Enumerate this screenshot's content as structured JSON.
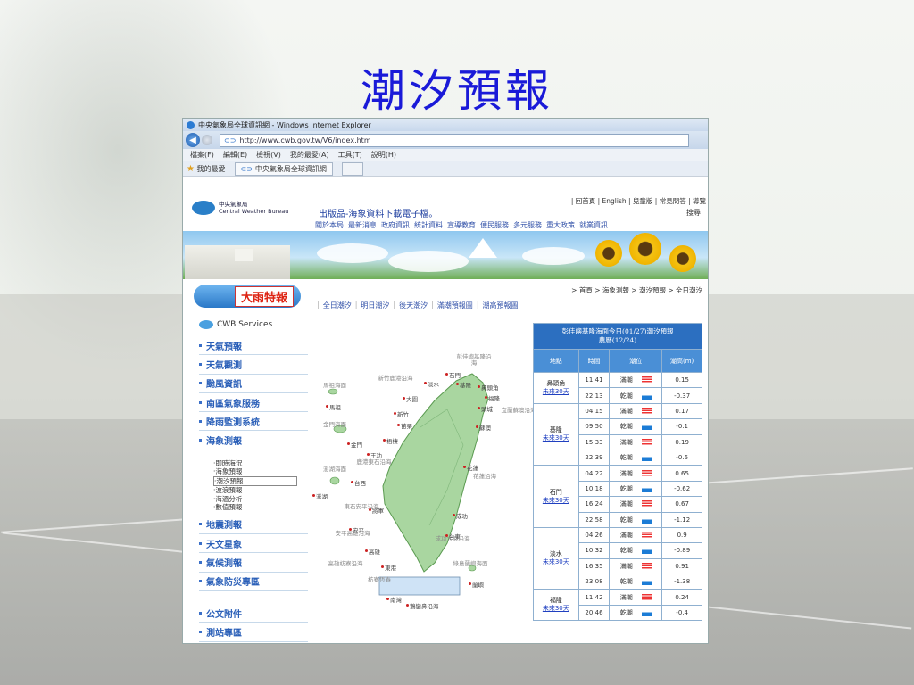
{
  "slide": {
    "title": "潮汐預報"
  },
  "browser": {
    "window_title": "中央氣象局全球資訊網 - Windows Internet Explorer",
    "url": "http://www.cwb.gov.tw/V6/index.htm",
    "menu": [
      "檔案(F)",
      "編輯(E)",
      "檢視(V)",
      "我的最愛(A)",
      "工具(T)",
      "說明(H)"
    ],
    "favorites_label": "我的最愛",
    "tab_label": "中央氣象局全球資訊網"
  },
  "site": {
    "logo_cn": "中央氣象局",
    "logo_en": "Central Weather Bureau",
    "top_links": "| 回首頁 | English | 兒童版 | 常見問答 | 導覽",
    "search_label": "搜尋",
    "promo": "出版品-海象資料下載電子檔。",
    "main_nav": [
      "關於本局",
      "最新消息",
      "政府資訊",
      "統計資料",
      "宣導教育",
      "便民服務",
      "多元服務",
      "重大政策",
      "就業資訊"
    ],
    "warning_label": "大雨特報",
    "breadcrumb": "> 首頁  > 海象測報  > 潮汐預報  > 全日潮汐",
    "tide_nav": [
      "全日潮汐",
      "明日潮汐",
      "後天潮汐",
      "滿潮預報圖",
      "潮高預報圖"
    ],
    "cwb_services": "CWB Services",
    "sidebar": [
      "天氣預報",
      "天氣觀測",
      "颱風資訊",
      "南區氣象服務",
      "降雨監測系統",
      "海象測報"
    ],
    "sidebar_sub": [
      "‧即時海況",
      "‧海象預報",
      "‧潮汐預報",
      "‧波浪預報",
      "‧海溫分析",
      "‧數值預報"
    ],
    "sidebar_more": [
      "地震測報",
      "天文星象",
      "氣候測報",
      "氣象防災專區"
    ],
    "sidebar_extra": [
      "公文附件",
      "測站專區"
    ]
  },
  "map": {
    "cities": [
      "石門",
      "淡水",
      "基隆",
      "鼻頭角",
      "福隆",
      "頭城",
      "蘇澳",
      "大園",
      "新竹",
      "苗栗",
      "馬祖",
      "金門",
      "梧棲",
      "王功",
      "台西",
      "澎湖",
      "將軍",
      "安平",
      "成功",
      "台東",
      "高雄",
      "東港",
      "花蓮",
      "蘭嶼",
      "南灣",
      "鵝鑾鼻沿海"
    ],
    "seas": [
      "彭佳嶼基隆沿海",
      "馬祖海面",
      "新竹鹿港沿海",
      "宜蘭蘇澳沿海",
      "金門海面",
      "鹿港東石沿海",
      "澎湖海面",
      "花蓮沿海",
      "東石安平沿海",
      "安平高雄沿海",
      "成功大武沿海",
      "高雄枋寮沿海",
      "枋寮恆春",
      "綠島蘭嶼海面"
    ]
  },
  "tide_table": {
    "caption": "彭佳嶼基隆海面今日(01/27)潮汐預報",
    "caption2": "農曆(12/24)",
    "headers": [
      "地點",
      "時間",
      "潮位",
      "潮高(m)"
    ],
    "future_link": "未來30天",
    "stations": [
      {
        "name": "鼻頭角",
        "rows": [
          [
            "11:41",
            "滿潮",
            "0.15"
          ],
          [
            "22:13",
            "乾潮",
            "-0.37"
          ]
        ]
      },
      {
        "name": "基隆",
        "rows": [
          [
            "04:15",
            "滿潮",
            "0.17"
          ],
          [
            "09:50",
            "乾潮",
            "-0.1"
          ],
          [
            "15:33",
            "滿潮",
            "0.19"
          ],
          [
            "22:39",
            "乾潮",
            "-0.6"
          ]
        ]
      },
      {
        "name": "石門",
        "rows": [
          [
            "04:22",
            "滿潮",
            "0.65"
          ],
          [
            "10:18",
            "乾潮",
            "-0.62"
          ],
          [
            "16:24",
            "滿潮",
            "0.67"
          ],
          [
            "22:58",
            "乾潮",
            "-1.12"
          ]
        ]
      },
      {
        "name": "淡水",
        "rows": [
          [
            "04:26",
            "滿潮",
            "0.9"
          ],
          [
            "10:32",
            "乾潮",
            "-0.89"
          ],
          [
            "16:35",
            "滿潮",
            "0.91"
          ],
          [
            "23:08",
            "乾潮",
            "-1.38"
          ]
        ]
      },
      {
        "name": "福隆",
        "rows": [
          [
            "11:42",
            "滿潮",
            "0.24"
          ],
          [
            "20:46",
            "乾潮",
            "-0.4"
          ]
        ]
      }
    ]
  }
}
